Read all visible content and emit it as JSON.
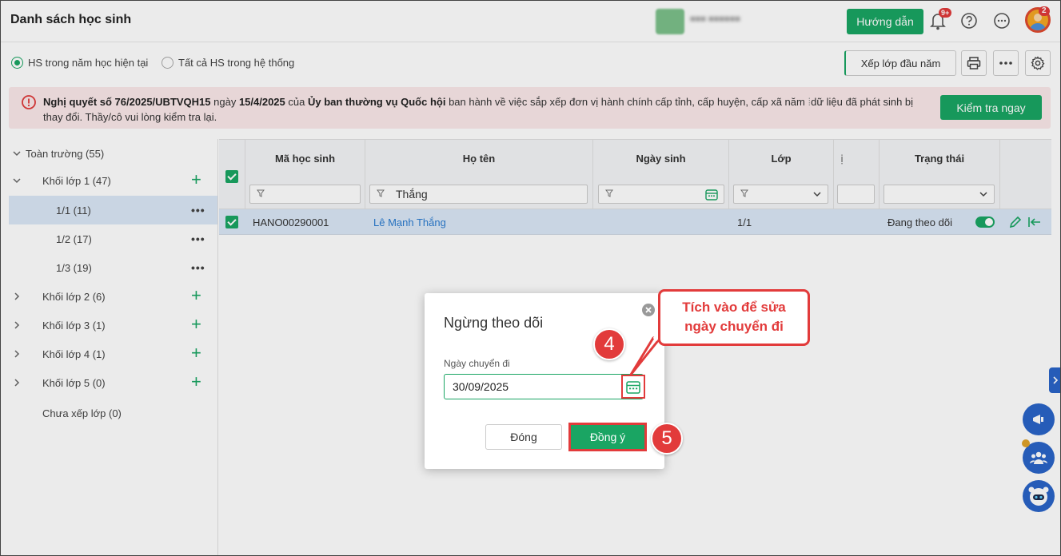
{
  "header": {
    "title": "Danh sách học sinh",
    "guide_label": "Hướng dẫn",
    "notif_badge": "9+",
    "avatar_badge": "2"
  },
  "filters": {
    "radio_current": "HS trong năm học hiện tại",
    "radio_all": "Tất cả HS trong hệ thống",
    "arrange_label": "Xếp lớp đầu năm"
  },
  "notice": {
    "part1": "Nghị quyết số 76/2025/UBTVQH15",
    "part2": " ngày ",
    "part3": "15/4/2025",
    "part4": " của ",
    "part5": "Ủy ban thường vụ Quốc hội",
    "part6": " ban hành về việc sắp xếp đơn vị hành chính cấp tỉnh, cấp huyện, cấp xã năm ",
    "part7": "dữ liệu đã phát sinh bị thay đổi. Thầy/cô vui lòng kiểm tra lại.",
    "button": "Kiểm tra ngay"
  },
  "tree": {
    "root": "Toàn trường (55)",
    "items": [
      {
        "label": "Khối lớp 1 (47)"
      },
      {
        "label": "1/1 (11)"
      },
      {
        "label": "1/2 (17)"
      },
      {
        "label": "1/3 (19)"
      },
      {
        "label": "Khối lớp 2 (6)"
      },
      {
        "label": "Khối lớp 3 (1)"
      },
      {
        "label": "Khối lớp 4 (1)"
      },
      {
        "label": "Khối lớp 5 (0)"
      },
      {
        "label": "Chưa xếp lớp (0)"
      }
    ]
  },
  "table": {
    "columns": [
      "Mã học sinh",
      "Họ tên",
      "Ngày sinh",
      "Lớp",
      "ị",
      "Trạng thái"
    ],
    "name_filter": "Thắng",
    "row": {
      "code": "HANO00290001",
      "name": "Lê Mạnh Thắng",
      "dob": "",
      "class": "1/1",
      "status": "Đang theo dõi"
    }
  },
  "modal": {
    "title": "Ngừng theo dõi",
    "field_label": "Ngày chuyển đi",
    "date_value": "30/09/2025",
    "close_label": "Đóng",
    "ok_label": "Đồng ý"
  },
  "annotations": {
    "step4": "4",
    "step5": "5",
    "callout_line1": "Tích vào để sửa",
    "callout_line2": "ngày chuyển đi"
  }
}
